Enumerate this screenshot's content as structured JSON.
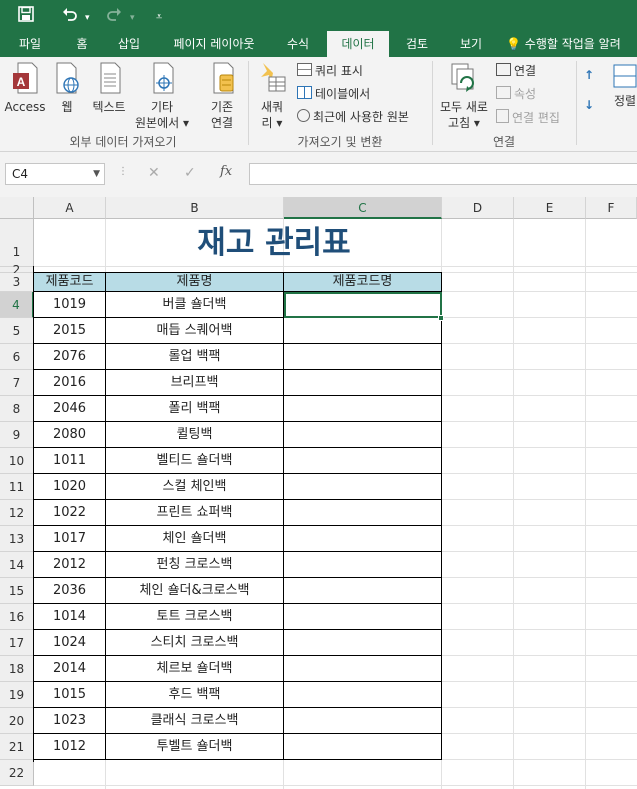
{
  "quick_access": {
    "save_icon": "save-icon",
    "undo_icon": "undo-icon",
    "redo_icon": "redo-icon",
    "customize_icon": "customize-icon"
  },
  "tabs": [
    {
      "label": "파일"
    },
    {
      "label": "홈"
    },
    {
      "label": "삽입"
    },
    {
      "label": "페이지 레이아웃"
    },
    {
      "label": "수식"
    },
    {
      "label": "데이터",
      "active": true
    },
    {
      "label": "검토"
    },
    {
      "label": "보기"
    }
  ],
  "tell_me": "수행할 작업을 알려",
  "ribbon": {
    "external": {
      "access": "Access",
      "web": "웹",
      "text": "텍스트",
      "other_1": "기타",
      "other_2": "원본에서 ▾",
      "existing_1": "기존",
      "existing_2": "연결",
      "group_label": "외부 데이터 가져오기"
    },
    "transform": {
      "new_query_1": "새쿼",
      "new_query_2": "리 ▾",
      "show_queries": "쿼리 표시",
      "from_table": "테이블에서",
      "recent_sources": "최근에 사용한 원본",
      "group_label": "가져오기 및 변환"
    },
    "connections": {
      "refresh_1": "모두 새로",
      "refresh_2": "고침 ▾",
      "connections": "연결",
      "properties": "속성",
      "edit_links": "연결 편집",
      "group_label": "연결"
    },
    "sort": {
      "sort_label": "정렬"
    }
  },
  "formula_bar": {
    "name_box": "C4",
    "cancel": "✕",
    "enter": "✓",
    "fx": "fx",
    "value": ""
  },
  "columns": [
    "A",
    "B",
    "C",
    "D",
    "E",
    "F"
  ],
  "rows": [
    "1",
    "2",
    "3",
    "4",
    "5",
    "6",
    "7",
    "8",
    "9",
    "10",
    "11",
    "12",
    "13",
    "14",
    "15",
    "16",
    "17",
    "18",
    "19",
    "20",
    "21",
    "22"
  ],
  "sheet": {
    "title": "재고 관리표",
    "headers": [
      "제품코드",
      "제품명",
      "제품코드명"
    ],
    "records": [
      {
        "code": "1019",
        "name": "버클 숄더백",
        "code_name": ""
      },
      {
        "code": "2015",
        "name": "매듭 스퀘어백",
        "code_name": ""
      },
      {
        "code": "2076",
        "name": "롤업 백팩",
        "code_name": ""
      },
      {
        "code": "2016",
        "name": "브리프백",
        "code_name": ""
      },
      {
        "code": "2046",
        "name": "폴리 백팩",
        "code_name": ""
      },
      {
        "code": "2080",
        "name": "퀼팅백",
        "code_name": ""
      },
      {
        "code": "1011",
        "name": "벨티드 숄더백",
        "code_name": ""
      },
      {
        "code": "1020",
        "name": "스컬 체인백",
        "code_name": ""
      },
      {
        "code": "1022",
        "name": "프린트 쇼퍼백",
        "code_name": ""
      },
      {
        "code": "1017",
        "name": "체인 숄더백",
        "code_name": ""
      },
      {
        "code": "2012",
        "name": "펀칭 크로스백",
        "code_name": ""
      },
      {
        "code": "2036",
        "name": "체인 숄더&크로스백",
        "code_name": ""
      },
      {
        "code": "1014",
        "name": "토트 크로스백",
        "code_name": ""
      },
      {
        "code": "1024",
        "name": "스티치 크로스백",
        "code_name": ""
      },
      {
        "code": "2014",
        "name": "체르보 숄더백",
        "code_name": ""
      },
      {
        "code": "1015",
        "name": "후드 백팩",
        "code_name": ""
      },
      {
        "code": "1023",
        "name": "클래식 크로스백",
        "code_name": ""
      },
      {
        "code": "1012",
        "name": "투벨트 숄더백",
        "code_name": ""
      }
    ]
  },
  "colors": {
    "excel_green": "#217346",
    "header_fill": "#b8dce6",
    "title_text": "#1f4e79"
  }
}
